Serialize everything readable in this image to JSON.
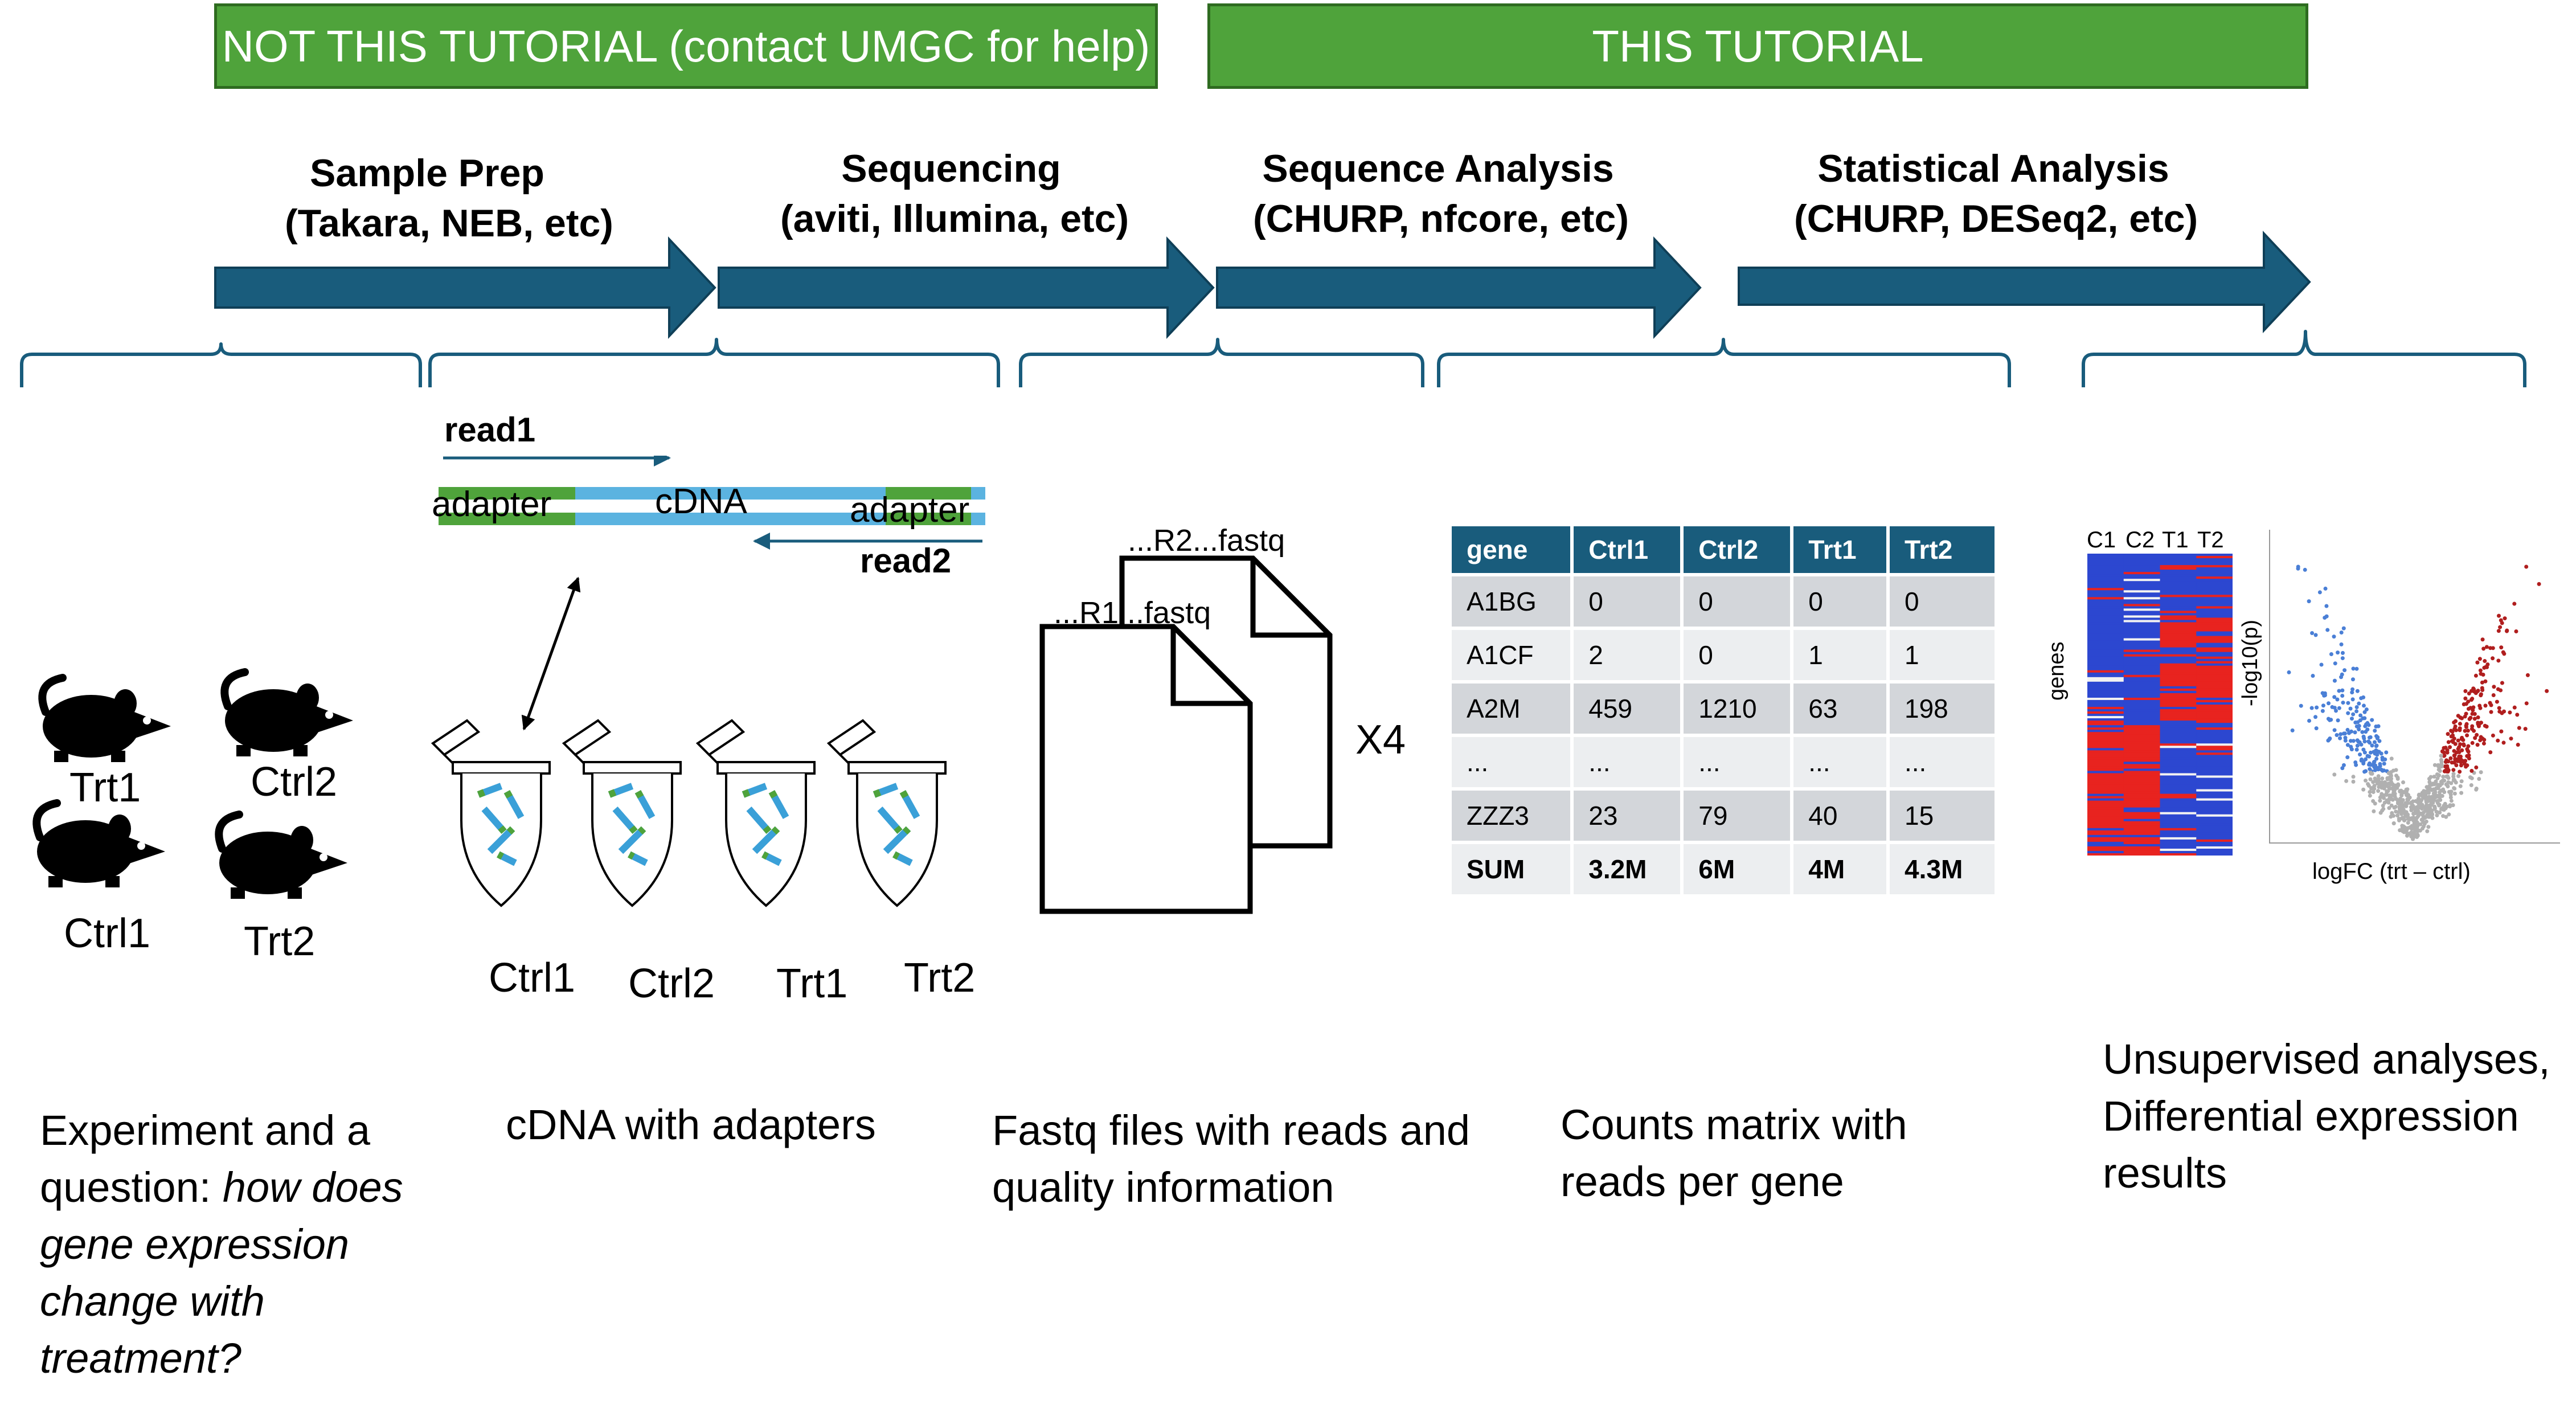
{
  "banners": {
    "not_this": "NOT THIS TUTORIAL (contact UMGC for help)",
    "this": "THIS TUTORIAL"
  },
  "stages": [
    {
      "title": "Sample Prep",
      "subtitle": "(Takara, NEB, etc)"
    },
    {
      "title": "Sequencing",
      "subtitle": "(aviti, Illumina, etc)"
    },
    {
      "title": "Sequence Analysis",
      "subtitle": "(CHURP, nfcore, etc)"
    },
    {
      "title": "Statistical Analysis",
      "subtitle": "(CHURP, DESeq2, etc)"
    }
  ],
  "mice": [
    "Trt1",
    "Ctrl2",
    "Ctrl1",
    "Trt2"
  ],
  "adapter_diagram": {
    "read1": "read1",
    "read2": "read2",
    "adapter_left": "adapter",
    "cdna": "cDNA",
    "adapter_right": "adapter"
  },
  "tubes": [
    "Ctrl1",
    "Ctrl2",
    "Trt1",
    "Trt2"
  ],
  "fastq": {
    "file_r2": "...R2...fastq",
    "file_r1": "...R1...fastq",
    "multiplier": "X4"
  },
  "counts_table": {
    "headers": [
      "gene",
      "Ctrl1",
      "Ctrl2",
      "Trt1",
      "Trt2"
    ],
    "rows": [
      [
        "A1BG",
        "0",
        "0",
        "0",
        "0"
      ],
      [
        "A1CF",
        "2",
        "0",
        "1",
        "1"
      ],
      [
        "A2M",
        "459",
        "1210",
        "63",
        "198"
      ],
      [
        "...",
        "...",
        "...",
        "...",
        "..."
      ],
      [
        "ZZZ3",
        "23",
        "79",
        "40",
        "15"
      ],
      [
        "SUM",
        "3.2M",
        "6M",
        "4M",
        "4.3M"
      ]
    ]
  },
  "heatmap": {
    "columns": [
      "C1",
      "C2",
      "T1",
      "T2"
    ],
    "ylabel": "genes",
    "colors": {
      "high": "#e8231f",
      "low": "#2c47d0",
      "mid": "#f2f2f2"
    }
  },
  "volcano": {
    "xlabel": "logFC (trt – ctrl)",
    "ylabel": "-log10(p)"
  },
  "descriptions": {
    "experiment_plain": "Experiment and a question: ",
    "experiment_italic": "how does gene expression change with treatment?",
    "cdna": "cDNA with adapters",
    "fastq": "Fastq files with reads and quality information",
    "counts": "Counts matrix with reads per gene",
    "results": "Unsupervised analyses, Differential expression results"
  },
  "colors": {
    "banner_green": "#4fa33b",
    "arrow_blue": "#195c7c",
    "adapter_green": "#4fa33b",
    "cdna_blue": "#5bb3e0",
    "table_header": "#195c7c"
  }
}
